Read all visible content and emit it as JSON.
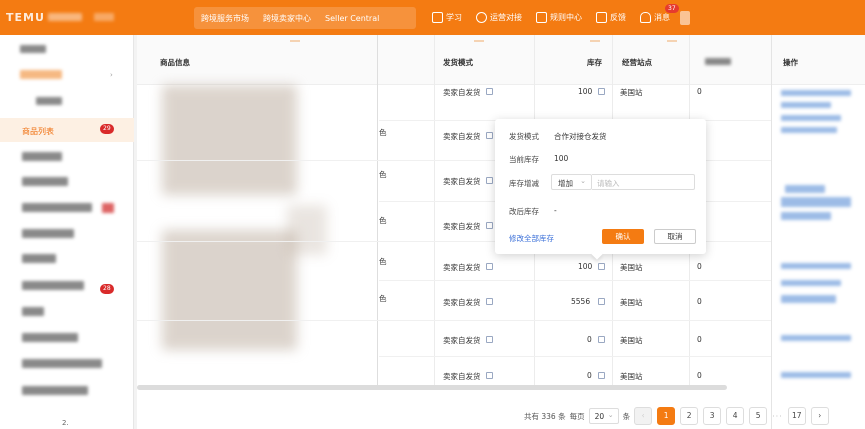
{
  "topbar": {
    "brand": "TEMU",
    "nav_links": [
      "跨境服务市场",
      "跨境卖家中心",
      "Seller Central"
    ],
    "right_items": [
      {
        "label": "学习",
        "icon": "book-icon"
      },
      {
        "label": "运营对接",
        "icon": "chat-icon"
      },
      {
        "label": "规则中心",
        "icon": "document-icon"
      },
      {
        "label": "反馈",
        "icon": "feedback-icon"
      },
      {
        "label": "消息",
        "icon": "bell-icon",
        "badge": "37"
      }
    ]
  },
  "sidebar": {
    "active_label": "商品列表",
    "active_badge": "29",
    "other_badge": "28",
    "bottom_text": "2."
  },
  "table": {
    "headers": {
      "product_info": "商品信息",
      "shipping_mode": "发货模式",
      "stock": "库存",
      "site": "经营站点",
      "actions": "操作"
    },
    "color_fragment": "色",
    "rows": [
      {
        "mode": "卖家自发货",
        "stock": "100",
        "site": "美国站",
        "extra": "0"
      },
      {
        "mode": "卖家自发货",
        "stock": "",
        "site": "",
        "extra": ""
      },
      {
        "mode": "卖家自发货",
        "stock": "",
        "site": "",
        "extra": ""
      },
      {
        "mode": "卖家自发货",
        "stock": "",
        "site": "",
        "extra": ""
      },
      {
        "mode": "卖家自发货",
        "stock": "100",
        "site": "美国站",
        "extra": "0"
      },
      {
        "mode": "卖家自发货",
        "stock": "5556",
        "site": "美国站",
        "extra": "0"
      },
      {
        "mode": "卖家自发货",
        "stock": "0",
        "site": "美国站",
        "extra": "0"
      },
      {
        "mode": "卖家自发货",
        "stock": "0",
        "site": "美国站",
        "extra": "0"
      }
    ]
  },
  "popover": {
    "mode_label": "发货模式",
    "mode_value": "合作对接仓发货",
    "current_label": "当前库存",
    "current_value": "100",
    "change_label": "库存增减",
    "change_select": "增加",
    "change_placeholder": "请输入",
    "after_label": "改后库存",
    "after_value": "-",
    "link": "修改全部库存",
    "confirm": "确认",
    "cancel": "取消"
  },
  "pagination": {
    "total_text": "共有 336 条",
    "per_page_label": "每页",
    "per_page_value": "20",
    "per_page_unit": "条",
    "pages": [
      "1",
      "2",
      "3",
      "4",
      "5"
    ],
    "ellipsis": "···",
    "last_page": "17",
    "prev": "‹",
    "next": "›"
  }
}
